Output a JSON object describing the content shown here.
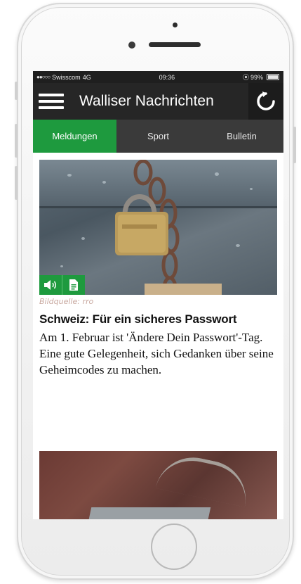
{
  "status_bar": {
    "carrier": "Swisscom",
    "network": "4G",
    "time": "09:36",
    "battery": "99%"
  },
  "app_bar": {
    "title": "Walliser Nachrichten"
  },
  "tabs": [
    {
      "label": "Meldungen",
      "active": true
    },
    {
      "label": "Sport",
      "active": false
    },
    {
      "label": "Bulletin",
      "active": false
    }
  ],
  "article": {
    "image_credit": "Bildquelle: rro",
    "headline": "Schweiz: Für ein sicheres Passwort",
    "teaser": "Am 1. Februar ist 'Ändere Dein Passwort'-Tag. Eine gute Gelegenheit, sich Gedanken über seine Geheimcodes zu machen.",
    "actions": [
      "speaker-icon",
      "document-icon"
    ]
  },
  "colors": {
    "accent_green": "#1e9a3e",
    "app_bar": "#262626",
    "tab_bar": "#3a3a3a"
  }
}
